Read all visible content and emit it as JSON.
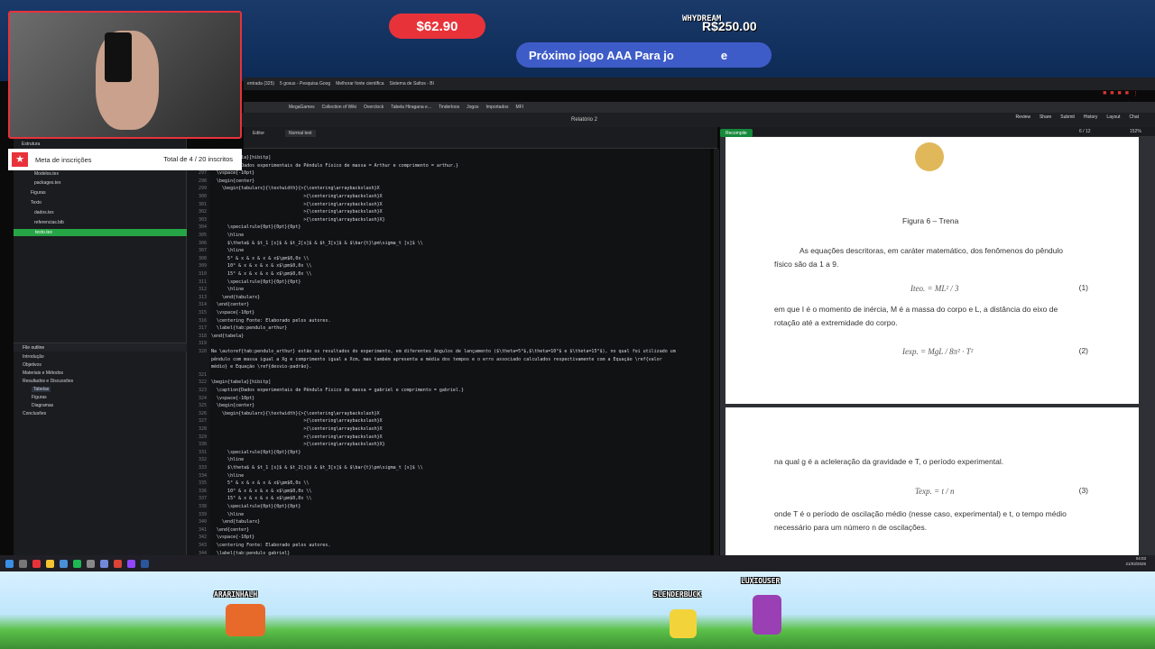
{
  "overlay": {
    "donation": "$62.90",
    "goal_user": "WHYDREAM",
    "goal_amount": "R$250.00",
    "goal_text": "Próximo jogo AAA Para jo",
    "goal_text_end": "e",
    "subs_label": "Meta de inscrições",
    "subs_total": "Total de 4 / 20 inscritos",
    "players": [
      "ARARINHALH",
      "SLENDERBUCK",
      "LUXIOUSER"
    ]
  },
  "browser": {
    "tabs": [
      "entrada (325)",
      "5 gosus - Pesquisa Goog",
      "Melhorar fonte científica",
      "Sistema de Saltos - Bl"
    ],
    "bookmarks": [
      "MegaGames",
      "Collection of Wiki",
      "Overclock",
      "Tabela Hiragana e...",
      "Tinderloos",
      "Jogos",
      "Importados",
      "MFI"
    ]
  },
  "overleaf": {
    "title": "Relatório 2",
    "actions": [
      "Review",
      "Share",
      "Submit",
      "History",
      "Layout",
      "Chat"
    ],
    "editor_label": "Editor",
    "style_select": "Normal text",
    "recompile": "Recompile",
    "page_indicator": "6 / 12",
    "zoom": "152%",
    "file_tree": [
      "Estrutura",
      "Modelos.tex",
      "packages.tex",
      "Figuras",
      "Texto",
      "dados.tex",
      "referencias.bib",
      "texto.tex"
    ],
    "outline_title": "File outline",
    "outline": [
      {
        "label": "Introdução",
        "indent": 0
      },
      {
        "label": "Objetivos",
        "indent": 0
      },
      {
        "label": "Materiais e Métodos",
        "indent": 0
      },
      {
        "label": "Resultados e Discussões",
        "indent": 0
      },
      {
        "label": "Tabelas",
        "indent": 1
      },
      {
        "label": "Figuras",
        "indent": 1
      },
      {
        "label": "Diagramas",
        "indent": 1
      },
      {
        "label": "Conclusões",
        "indent": 0
      }
    ]
  },
  "code": {
    "lines": [
      {
        "n": "295",
        "t": "\\begin{tabela}[hibitp]"
      },
      {
        "n": "296",
        "t": "  \\caption{Dados experimentais de Pêndulo Físico de massa = Arthur e comprimento = arthur.}"
      },
      {
        "n": "297",
        "t": "  \\vspace{-10pt}"
      },
      {
        "n": "298",
        "t": "  \\begin{center}"
      },
      {
        "n": "299",
        "t": "    \\begin{tabularx}{\\textwidth}{>{\\centering\\arraybackslash}X"
      },
      {
        "n": "300",
        "t": "                                  >{\\centering\\arraybackslash}X"
      },
      {
        "n": "301",
        "t": "                                  >{\\centering\\arraybackslash}X"
      },
      {
        "n": "302",
        "t": "                                  >{\\centering\\arraybackslash}X"
      },
      {
        "n": "303",
        "t": "                                  >{\\centering\\arraybackslash}X}"
      },
      {
        "n": "304",
        "t": "      \\specialrule{0pt}{0pt}{0pt}"
      },
      {
        "n": "305",
        "t": "      \\hline"
      },
      {
        "n": "306",
        "t": "      $\\theta$ & $t_1 [s]$ & $t_2[s]$ & $t_3[s]$ & $\\bar{t}\\pm\\sigma_t [s]$ \\\\"
      },
      {
        "n": "307",
        "t": "      \\hline"
      },
      {
        "n": "308",
        "t": "      5° & x & x & x & x$\\pm$0,0x \\\\"
      },
      {
        "n": "309",
        "t": "      10° & x & x & x & x$\\pm$0,0x \\\\"
      },
      {
        "n": "310",
        "t": "      15° & x & x & x & x$\\pm$0,0x \\\\"
      },
      {
        "n": "311",
        "t": "      \\specialrule{0pt}{0pt}{0pt}"
      },
      {
        "n": "312",
        "t": "      \\hline"
      },
      {
        "n": "313",
        "t": "    \\end{tabularx}"
      },
      {
        "n": "314",
        "t": "  \\end{center}"
      },
      {
        "n": "315",
        "t": "  \\vspace{-10pt}"
      },
      {
        "n": "316",
        "t": "  \\centering Fonte: Elaborado pelos autores."
      },
      {
        "n": "317",
        "t": "  \\label{tab:pendulo_arthur}"
      },
      {
        "n": "318",
        "t": "\\end{tabela}"
      },
      {
        "n": "319",
        "t": ""
      },
      {
        "n": "320",
        "t": "Na \\autoref{tab:pendulo_arthur} estão os resultados do experimento, em diferentes ângulos de lançamento ($\\theta=5°$,$\\theta=10°$ e $\\theta=15°$), no qual foi utilizado um"
      },
      {
        "n": "",
        "t": "pêndulo com massa igual a Xg e comprimento igual a Xcm, mas também apresenta a média dos tempos e o erro associado calculados respectivamente com a Equação \\ref{valor"
      },
      {
        "n": "",
        "t": "médio} e Equação \\ref{desvio-padrão}."
      },
      {
        "n": "321",
        "t": ""
      },
      {
        "n": "322",
        "t": "\\begin{tabela}[hibitp]"
      },
      {
        "n": "323",
        "t": "  \\caption{Dados experimentais de Pêndulo Físico de massa = gabriel e comprimento = gabriel.}"
      },
      {
        "n": "324",
        "t": "  \\vspace{-10pt}"
      },
      {
        "n": "325",
        "t": "  \\begin{center}"
      },
      {
        "n": "326",
        "t": "    \\begin{tabularx}{\\textwidth}{>{\\centering\\arraybackslash}X"
      },
      {
        "n": "327",
        "t": "                                  >{\\centering\\arraybackslash}X"
      },
      {
        "n": "328",
        "t": "                                  >{\\centering\\arraybackslash}X"
      },
      {
        "n": "329",
        "t": "                                  >{\\centering\\arraybackslash}X"
      },
      {
        "n": "330",
        "t": "                                  >{\\centering\\arraybackslash}X}"
      },
      {
        "n": "331",
        "t": "      \\specialrule{0pt}{0pt}{0pt}"
      },
      {
        "n": "332",
        "t": "      \\hline"
      },
      {
        "n": "333",
        "t": "      $\\theta$ & $t_1 [s]$ & $t_2[s]$ & $t_3[s]$ & $\\bar{t}\\pm\\sigma_t [s]$ \\\\"
      },
      {
        "n": "334",
        "t": "      \\hline"
      },
      {
        "n": "335",
        "t": "      5° & x & x & x & x$\\pm$0,0x \\\\"
      },
      {
        "n": "336",
        "t": "      10° & x & x & x & x$\\pm$0,0x \\\\"
      },
      {
        "n": "337",
        "t": "      15° & x & x & x & x$\\pm$0,0x \\\\"
      },
      {
        "n": "338",
        "t": "      \\specialrule{0pt}{0pt}{0pt}"
      },
      {
        "n": "339",
        "t": "      \\hline"
      },
      {
        "n": "340",
        "t": "    \\end{tabularx}"
      },
      {
        "n": "341",
        "t": "  \\end{center}"
      },
      {
        "n": "342",
        "t": "  \\vspace{-10pt}"
      },
      {
        "n": "343",
        "t": "  \\centering Fonte: Elaborado pelos autores."
      },
      {
        "n": "344",
        "t": "  \\label{tab:pendulo_gabriel}"
      }
    ]
  },
  "pdf": {
    "figure_caption": "Figura 6 – Trena",
    "para1": "As equações descritoras, em caráter matemático, dos fenômenos do pêndulo",
    "para1b": "físico são da 1 a 9.",
    "eq1": "Iteo. = ML² / 3",
    "eq1_num": "(1)",
    "para2": "em que I é o momento de inércia, M é a massa do corpo e L, a distância do eixo de",
    "para2b": "rotação até a extremidade do corpo.",
    "eq2": "Iexp. = MgL / 8π² · T²",
    "eq2_num": "(2)",
    "para3": "na qual g é a acleleração da gravidade e T, o período experimental.",
    "eq3": "Texp. = t / n",
    "eq3_num": "(3)",
    "para4": "onde T é o período de oscilação médio (nesse caso, experimental) e t, o tempo médio",
    "para4b": "necessário para um número n de oscilações."
  },
  "taskbar": {
    "time": "04:03",
    "date": "21/03/2025"
  }
}
